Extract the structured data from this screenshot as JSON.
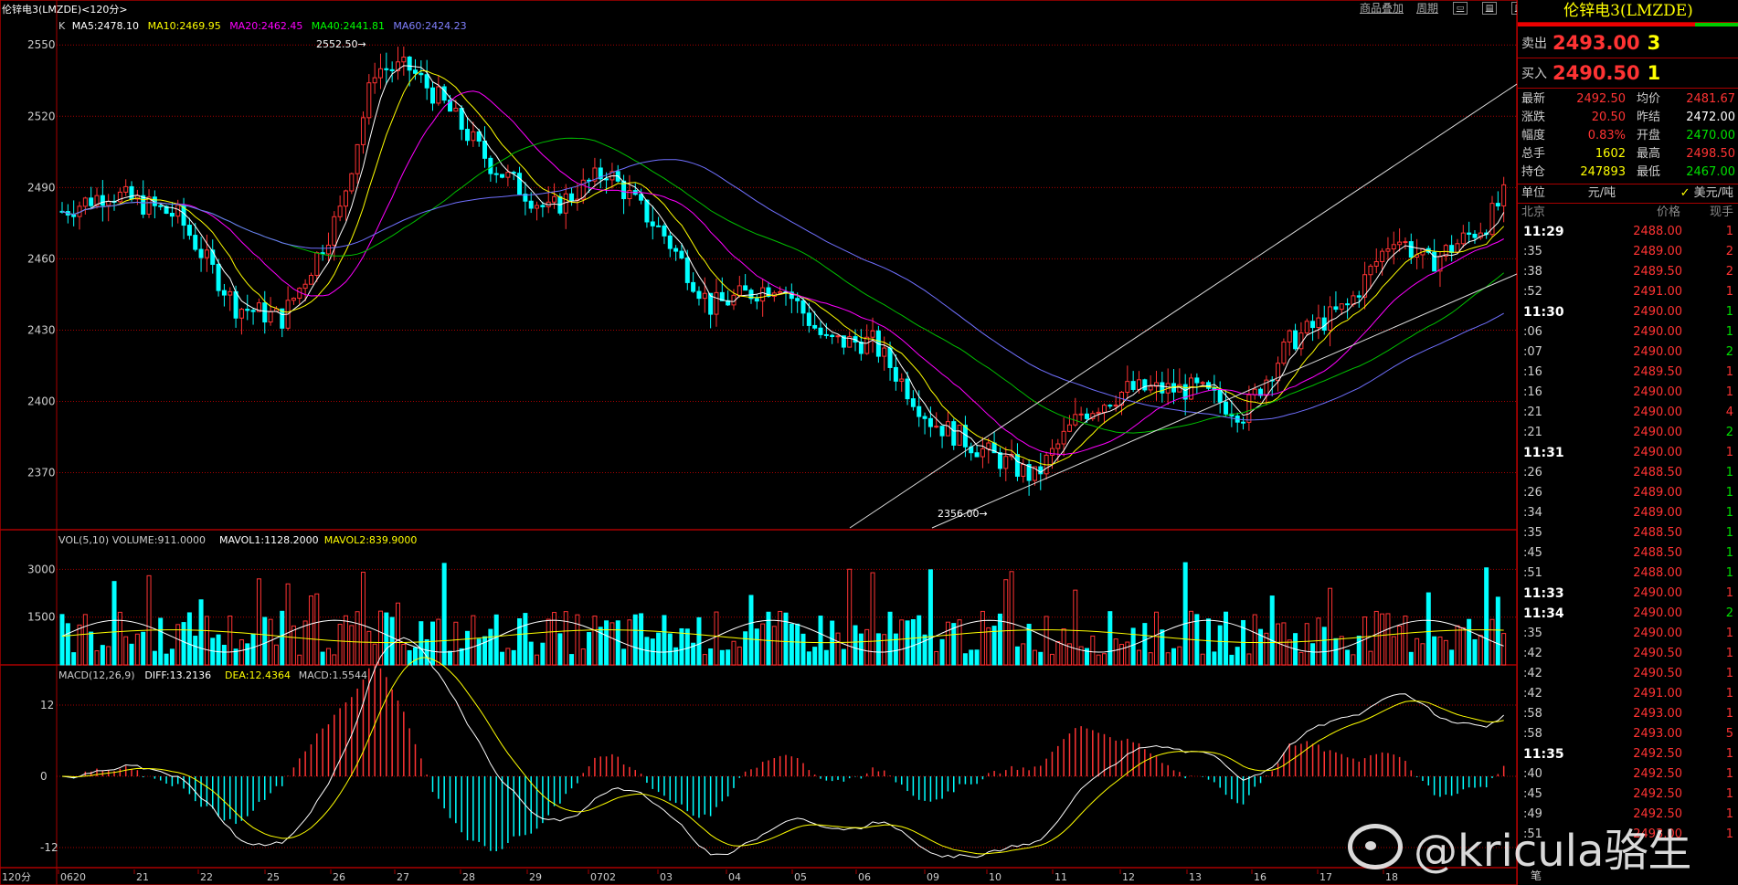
{
  "header": {
    "title": "伦锌电3(LMZDE)<120分>",
    "menu_overlay": "商品叠加",
    "menu_period": "周期"
  },
  "legend": {
    "k": "K",
    "ma5": "MA5:2478.10",
    "ma10": "MA10:2469.95",
    "ma20": "MA20:2462.45",
    "ma40": "MA40:2441.81",
    "ma60": "MA60:2424.23",
    "vol": "VOL(5,10) VOLUME:911.0000",
    "mavol1": "MAVOL1:1128.2000",
    "mavol2": "MAVOL2:839.9000",
    "macd": "MACD(12,26,9)",
    "diff": "DIFF:13.2136",
    "dea": "DEA:12.4364",
    "macdval": "MACD:1.5544"
  },
  "annotations": {
    "high": "2552.50",
    "low": "2356.00"
  },
  "price_axis": [
    "2550",
    "2520",
    "2490",
    "2460",
    "2430",
    "2400",
    "2370"
  ],
  "vol_axis": [
    "3000",
    "1500"
  ],
  "macd_axis": [
    "12",
    "0",
    "-12"
  ],
  "date_axis": [
    "120分",
    "0620",
    "21",
    "22",
    "25",
    "26",
    "27",
    "28",
    "29",
    "0702",
    "03",
    "04",
    "05",
    "06",
    "09",
    "10",
    "11",
    "12",
    "13",
    "16",
    "17",
    "18"
  ],
  "panel": {
    "title": "伦锌电3(LMZDE)",
    "sell_label": "卖出",
    "sell_price": "2493.00",
    "sell_qty": "3",
    "buy_label": "买入",
    "buy_price": "2490.50",
    "buy_qty": "1",
    "stats": [
      {
        "k": "最新",
        "v": "2492.50",
        "vc": "red",
        "k2": "均价",
        "v2": "2481.67",
        "v2c": "red"
      },
      {
        "k": "涨跌",
        "v": "20.50",
        "vc": "red",
        "k2": "昨结",
        "v2": "2472.00",
        "v2c": "white"
      },
      {
        "k": "幅度",
        "v": "0.83%",
        "vc": "red",
        "k2": "开盘",
        "v2": "2470.00",
        "v2c": "green"
      },
      {
        "k": "总手",
        "v": "1602",
        "vc": "yellow",
        "k2": "最高",
        "v2": "2498.50",
        "v2c": "red"
      },
      {
        "k": "持仓",
        "v": "247893",
        "vc": "yellow",
        "k2": "最低",
        "v2": "2467.00",
        "v2c": "green"
      }
    ],
    "unit_label": "单位",
    "unit_a": "元/吨",
    "unit_b": "美元/吨",
    "tick_head": {
      "t": "北京",
      "p": "价格",
      "q": "现手"
    },
    "ticks": [
      {
        "t": "11:29",
        "big": true,
        "p": "2488.00",
        "q": "1",
        "qc": "red"
      },
      {
        "t": ":35",
        "big": false,
        "p": "2489.00",
        "q": "2",
        "qc": "red"
      },
      {
        "t": ":38",
        "big": false,
        "p": "2489.50",
        "q": "2",
        "qc": "red"
      },
      {
        "t": ":52",
        "big": false,
        "p": "2491.00",
        "q": "1",
        "qc": "red"
      },
      {
        "t": "11:30",
        "big": true,
        "p": "2490.00",
        "q": "1",
        "qc": "green"
      },
      {
        "t": ":06",
        "big": false,
        "p": "2490.00",
        "q": "1",
        "qc": "green"
      },
      {
        "t": ":07",
        "big": false,
        "p": "2490.00",
        "q": "2",
        "qc": "green"
      },
      {
        "t": ":16",
        "big": false,
        "p": "2489.50",
        "q": "1",
        "qc": "red"
      },
      {
        "t": ":16",
        "big": false,
        "p": "2490.00",
        "q": "1",
        "qc": "red"
      },
      {
        "t": ":21",
        "big": false,
        "p": "2490.00",
        "q": "4",
        "qc": "red"
      },
      {
        "t": ":21",
        "big": false,
        "p": "2490.00",
        "q": "2",
        "qc": "green"
      },
      {
        "t": "11:31",
        "big": true,
        "p": "2490.00",
        "q": "1",
        "qc": "red"
      },
      {
        "t": ":26",
        "big": false,
        "p": "2488.50",
        "q": "1",
        "qc": "green"
      },
      {
        "t": ":26",
        "big": false,
        "p": "2489.00",
        "q": "1",
        "qc": "green"
      },
      {
        "t": ":34",
        "big": false,
        "p": "2489.00",
        "q": "1",
        "qc": "green"
      },
      {
        "t": ":35",
        "big": false,
        "p": "2488.50",
        "q": "1",
        "qc": "green"
      },
      {
        "t": ":45",
        "big": false,
        "p": "2488.50",
        "q": "1",
        "qc": "green"
      },
      {
        "t": ":51",
        "big": false,
        "p": "2488.00",
        "q": "1",
        "qc": "green"
      },
      {
        "t": "11:33",
        "big": true,
        "p": "2490.00",
        "q": "1",
        "qc": "red"
      },
      {
        "t": "11:34",
        "big": true,
        "p": "2490.00",
        "q": "2",
        "qc": "green"
      },
      {
        "t": ":35",
        "big": false,
        "p": "2490.00",
        "q": "1",
        "qc": "red"
      },
      {
        "t": ":42",
        "big": false,
        "p": "2490.50",
        "q": "1",
        "qc": "red"
      },
      {
        "t": ":42",
        "big": false,
        "p": "2490.50",
        "q": "1",
        "qc": "red"
      },
      {
        "t": ":42",
        "big": false,
        "p": "2491.00",
        "q": "1",
        "qc": "red"
      },
      {
        "t": ":58",
        "big": false,
        "p": "2493.00",
        "q": "1",
        "qc": "red"
      },
      {
        "t": ":58",
        "big": false,
        "p": "2493.00",
        "q": "5",
        "qc": "red"
      },
      {
        "t": "11:35",
        "big": true,
        "p": "2492.50",
        "q": "1",
        "qc": "red"
      },
      {
        "t": ":40",
        "big": false,
        "p": "2492.50",
        "q": "1",
        "qc": "red"
      },
      {
        "t": ":45",
        "big": false,
        "p": "2492.50",
        "q": "1",
        "qc": "red"
      },
      {
        "t": ":49",
        "big": false,
        "p": "2492.50",
        "q": "1",
        "qc": "red"
      },
      {
        "t": ":51",
        "big": false,
        "p": "2493.00",
        "q": "1",
        "qc": "red"
      }
    ],
    "footer": "笔"
  },
  "watermark": "@kricula骆生",
  "colors": {
    "up": "#ff3333",
    "down": "#00ffff",
    "grid": "#aa0000",
    "ma5": "#ffffff",
    "ma10": "#ffff00",
    "ma20": "#ff00ff",
    "ma40": "#00c000",
    "ma60": "#7070ff"
  }
}
